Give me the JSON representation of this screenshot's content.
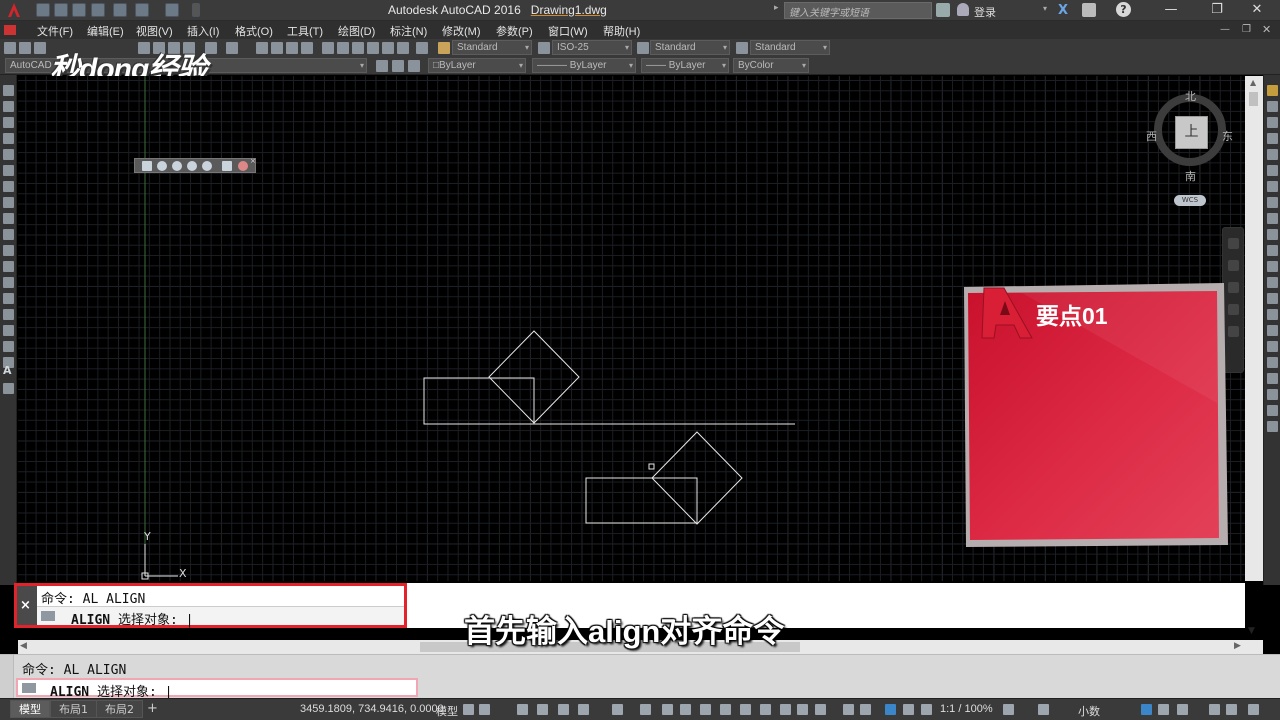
{
  "window": {
    "app_title": "Autodesk AutoCAD 2016",
    "drawing_name": "Drawing1.dwg",
    "search_placeholder": "键入关键字或短语",
    "login_label": "登录",
    "minimize": "—",
    "restore": "❐",
    "close": "✕"
  },
  "menu": {
    "items": [
      "文件(F)",
      "编辑(E)",
      "视图(V)",
      "插入(I)",
      "格式(O)",
      "工具(T)",
      "绘图(D)",
      "标注(N)",
      "修改(M)",
      "参数(P)",
      "窗口(W)",
      "帮助(H)"
    ]
  },
  "toolbar": {
    "text_style": "Standard",
    "dim_style": "ISO-25",
    "table_style": "Standard",
    "multileader_style": "Standard",
    "workspace": "AutoCAD",
    "layer_color": "ByLayer",
    "linetype": "ByLayer",
    "lineweight": "ByLayer",
    "plot_style": "ByColor"
  },
  "viewcube": {
    "north": "北",
    "south": "南",
    "east": "东",
    "west": "西",
    "face": "上",
    "wcs": "WCS"
  },
  "ucs": {
    "y_label": "Y",
    "x_label": "X"
  },
  "tip_panel": {
    "title": "要点01",
    "colors": {
      "panel": "#d51c3a",
      "border": "#b7aeb0"
    }
  },
  "command_float": {
    "history": "命令: AL ALIGN",
    "prompt_cmd": "ALIGN",
    "prompt_text": "选择对象:",
    "close": "×"
  },
  "subtitle": "首先输入align对齐命令",
  "command_docked": {
    "history": "命令: AL ALIGN",
    "prompt_cmd": "ALIGN",
    "prompt_text": "选择对象:"
  },
  "statusbar": {
    "tabs": [
      "模型",
      "布局1",
      "布局2"
    ],
    "add_tab": "+",
    "coordinates": "3459.1809, 734.9416, 0.0000",
    "model_label": "模型",
    "scale": "1:1 / 100%",
    "units": "小数"
  },
  "watermark": "秒dong经验"
}
